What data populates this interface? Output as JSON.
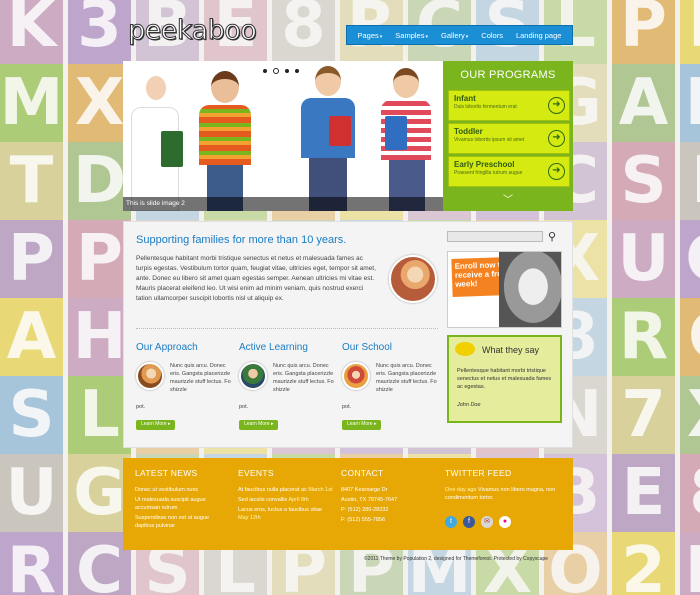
{
  "header": {
    "logo": "peekaboo",
    "nav": [
      {
        "label": "Pages",
        "caret": "▾"
      },
      {
        "label": "Samples",
        "caret": "▾"
      },
      {
        "label": "Gallery",
        "caret": "▾"
      },
      {
        "label": "Colors",
        "caret": ""
      },
      {
        "label": "Landing page",
        "caret": ""
      }
    ]
  },
  "slider": {
    "caption": "This is slide image 2",
    "dots": 4,
    "active_dot": 1
  },
  "programs": {
    "title": "OUR PROGRAMS",
    "items": [
      {
        "title": "Infant",
        "subtitle": "Duis lobortis fermentum erat"
      },
      {
        "title": "Toddler",
        "subtitle": "Vivamus lobortis ipsum sit amet"
      },
      {
        "title": "Early Preschool",
        "subtitle": "Praesent fringilla rutrum augue"
      }
    ],
    "more_icon": "chevron-down-icon"
  },
  "main": {
    "headline": "Supporting families for more than 10 years.",
    "intro": "Pellentesque habitant morbi tristique senectus et netus et malesuada fames ac turpis egestas. Vestibulum tortor quam, feugiat vitae, ultricies eget, tempor sit amet, ante. Donec eu libero sit amet quam egestas semper. Aenean ultricies mi vitae est. Mauris placerat eleifend leo. Ut wisi enim ad minim veniam, quis nostrud exerci tation ullamcorper suscipit lobortis nisl ut aliquip ex.",
    "columns": [
      {
        "title": "Our Approach",
        "text": "Nunc quis arcu. Donec eris. Gangsta placerizzle maurizzle stuff lectus. Fo shizzle",
        "tail": "pot.",
        "more": "Learn More ▸"
      },
      {
        "title": "Active Learning",
        "text": "Nunc quis arcu. Donec eris. Gangsta placerizzle maurizzle stuff lectus. Fo shizzle",
        "tail": "pot.",
        "more": "Learn More ▸"
      },
      {
        "title": "Our School",
        "text": "Nunc quis arcu. Donec eris. Gangsta placerizzle maurizzle stuff lectus. Fo shizzle",
        "tail": "pot.",
        "more": "Learn More ▸"
      }
    ],
    "search": {
      "placeholder": ""
    },
    "enroll": "Enroll now to receive a free week!",
    "testimonial": {
      "title": "What they say",
      "text": "Pellentesque habitant morbi tristique senectus et netus et malesuada fames ac egestas.",
      "author": "John Doe"
    }
  },
  "footer": {
    "news": {
      "title": "LATEST NEWS",
      "items": [
        "Donec ut vestibulum nunc",
        "Ut malesuada suscipit augue accumsan rutrum",
        "Suspendisse non est ut augue dapibus pulvinar"
      ]
    },
    "events": {
      "title": "EVENTS",
      "items": [
        {
          "text": "At faucibus nulla placerat ac",
          "date": "March 1st"
        },
        {
          "text": "Sed iaculis convallis",
          "date": "April 8th"
        },
        {
          "text": "Lacus eros, luctus a faucibus vitae",
          "date": "May 12th"
        }
      ]
    },
    "contact": {
      "title": "CONTACT",
      "lines": [
        "8407 Kearsarge Dr",
        "Austin, TX 78745-7647",
        "P: (512) 280-28232",
        "F: (512) 555-7856"
      ]
    },
    "twitter": {
      "title": "TWITTER FEED",
      "when": "One day ago",
      "text": "Vivamus non libero magna, non condimentum tortor."
    },
    "social_icons": [
      "twitter-icon",
      "facebook-icon",
      "mail-icon",
      "flickr-icon"
    ],
    "copyright": "©2011 Theme by Population 2, designed for Themeforest. Protected by Copyscape"
  },
  "colors": {
    "accent_blue": "#1b8fd6",
    "program_green": "#7ab51d",
    "program_item": "#d4ea10",
    "footer_orange": "#e7a806"
  }
}
